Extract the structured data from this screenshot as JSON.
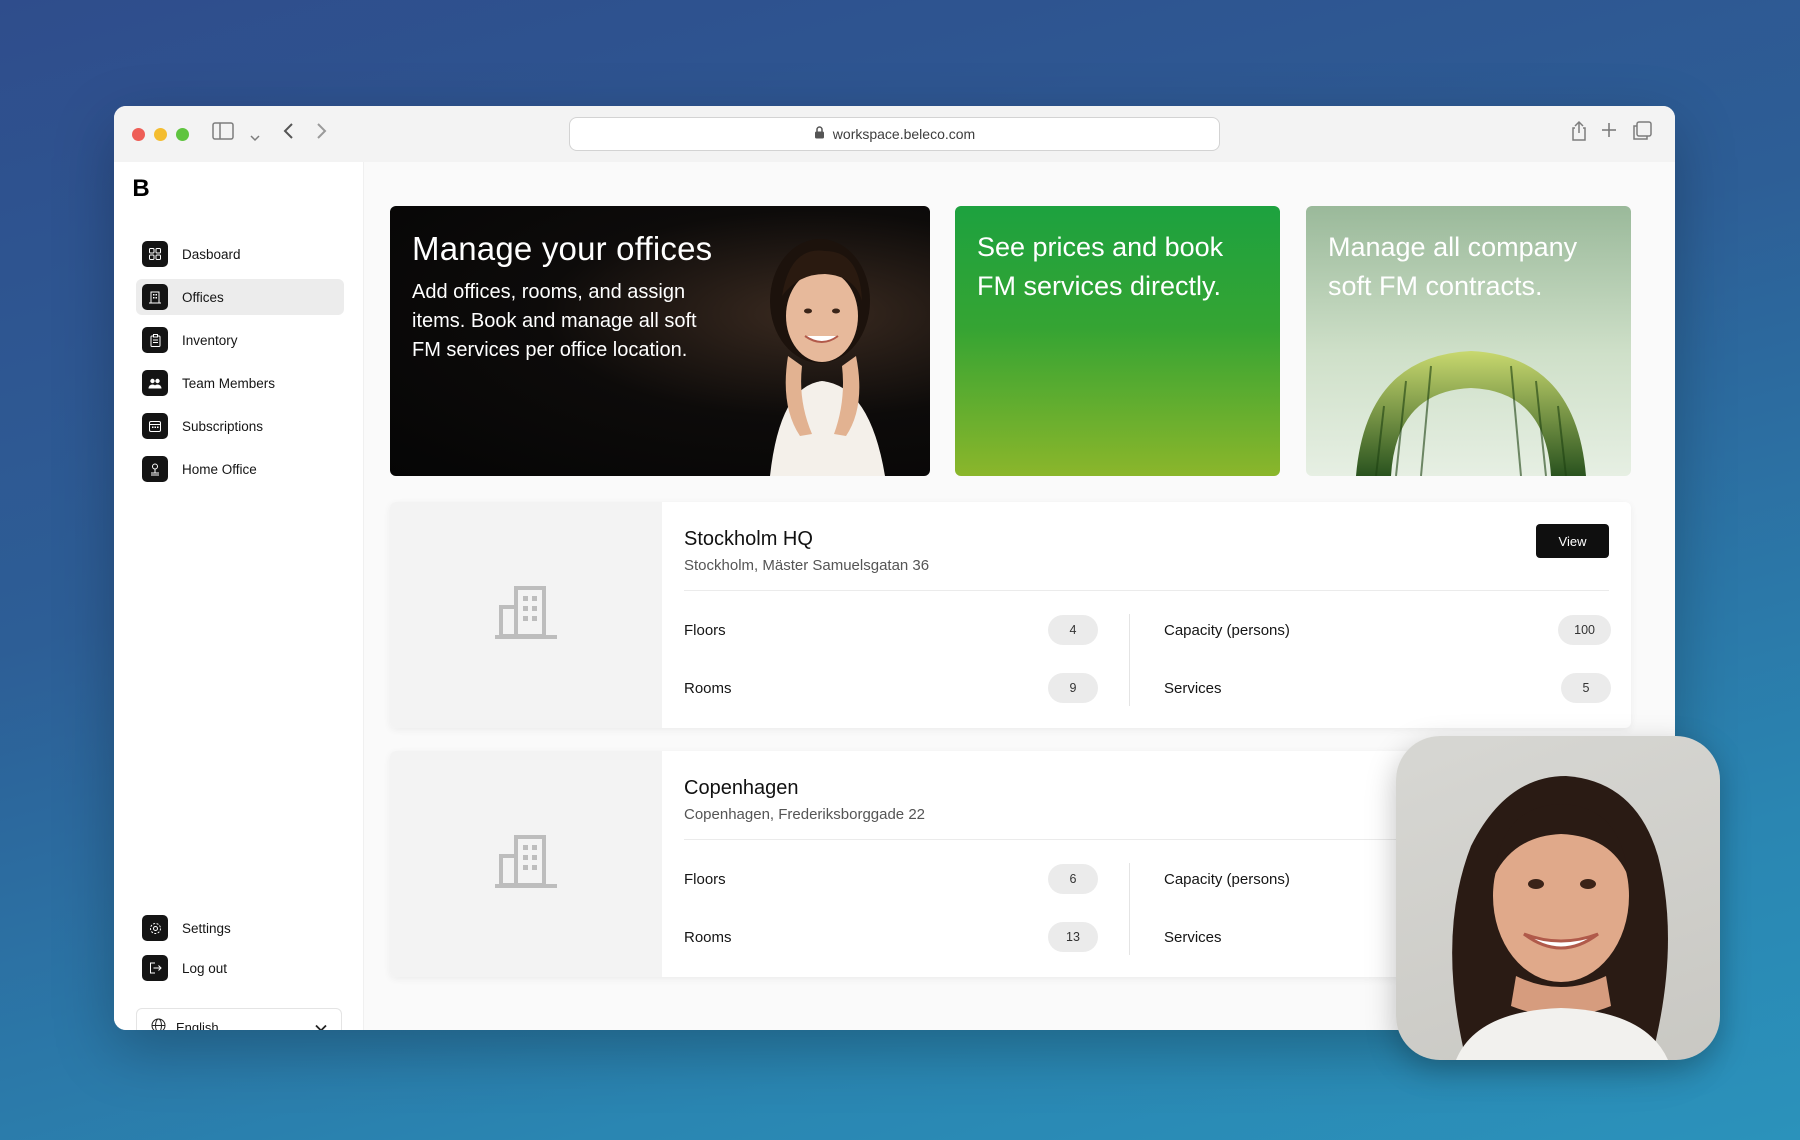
{
  "browser": {
    "url": "workspace.beleco.com"
  },
  "sidebar": {
    "logo": "B",
    "items": [
      {
        "label": "Dasboard",
        "icon": "grid-icon"
      },
      {
        "label": "Offices",
        "icon": "building-icon",
        "active": true
      },
      {
        "label": "Inventory",
        "icon": "clipboard-icon"
      },
      {
        "label": "Team Members",
        "icon": "people-icon"
      },
      {
        "label": "Subscriptions",
        "icon": "calendar-icon"
      },
      {
        "label": "Home Office",
        "icon": "desk-icon"
      }
    ],
    "bottom_items": [
      {
        "label": "Settings",
        "icon": "gear-icon"
      },
      {
        "label": "Log out",
        "icon": "logout-icon"
      }
    ],
    "language": "English"
  },
  "heroes": [
    {
      "title": "Manage your offices",
      "text": "Add offices, rooms, and assign items. Book and manage all soft FM services per office location."
    },
    {
      "text": "See prices and book FM services directly."
    },
    {
      "text": "Manage all company soft FM contracts."
    }
  ],
  "offices": [
    {
      "name": "Stockholm HQ",
      "address": "Stockholm, Mäster Samuelsgatan 36",
      "view_label": "View",
      "floors_label": "Floors",
      "floors": "4",
      "rooms_label": "Rooms",
      "rooms": "9",
      "capacity_label": "Capacity (persons)",
      "capacity": "100",
      "services_label": "Services",
      "services": "5"
    },
    {
      "name": "Copenhagen",
      "address": "Copenhagen, Frederiksborggade 22",
      "floors_label": "Floors",
      "floors": "6",
      "rooms_label": "Rooms",
      "rooms": "13",
      "capacity_label": "Capacity (persons)",
      "services_label": "Services"
    }
  ],
  "colors": {
    "accent_green": "#1da23f",
    "dark": "#0f0f0f"
  }
}
